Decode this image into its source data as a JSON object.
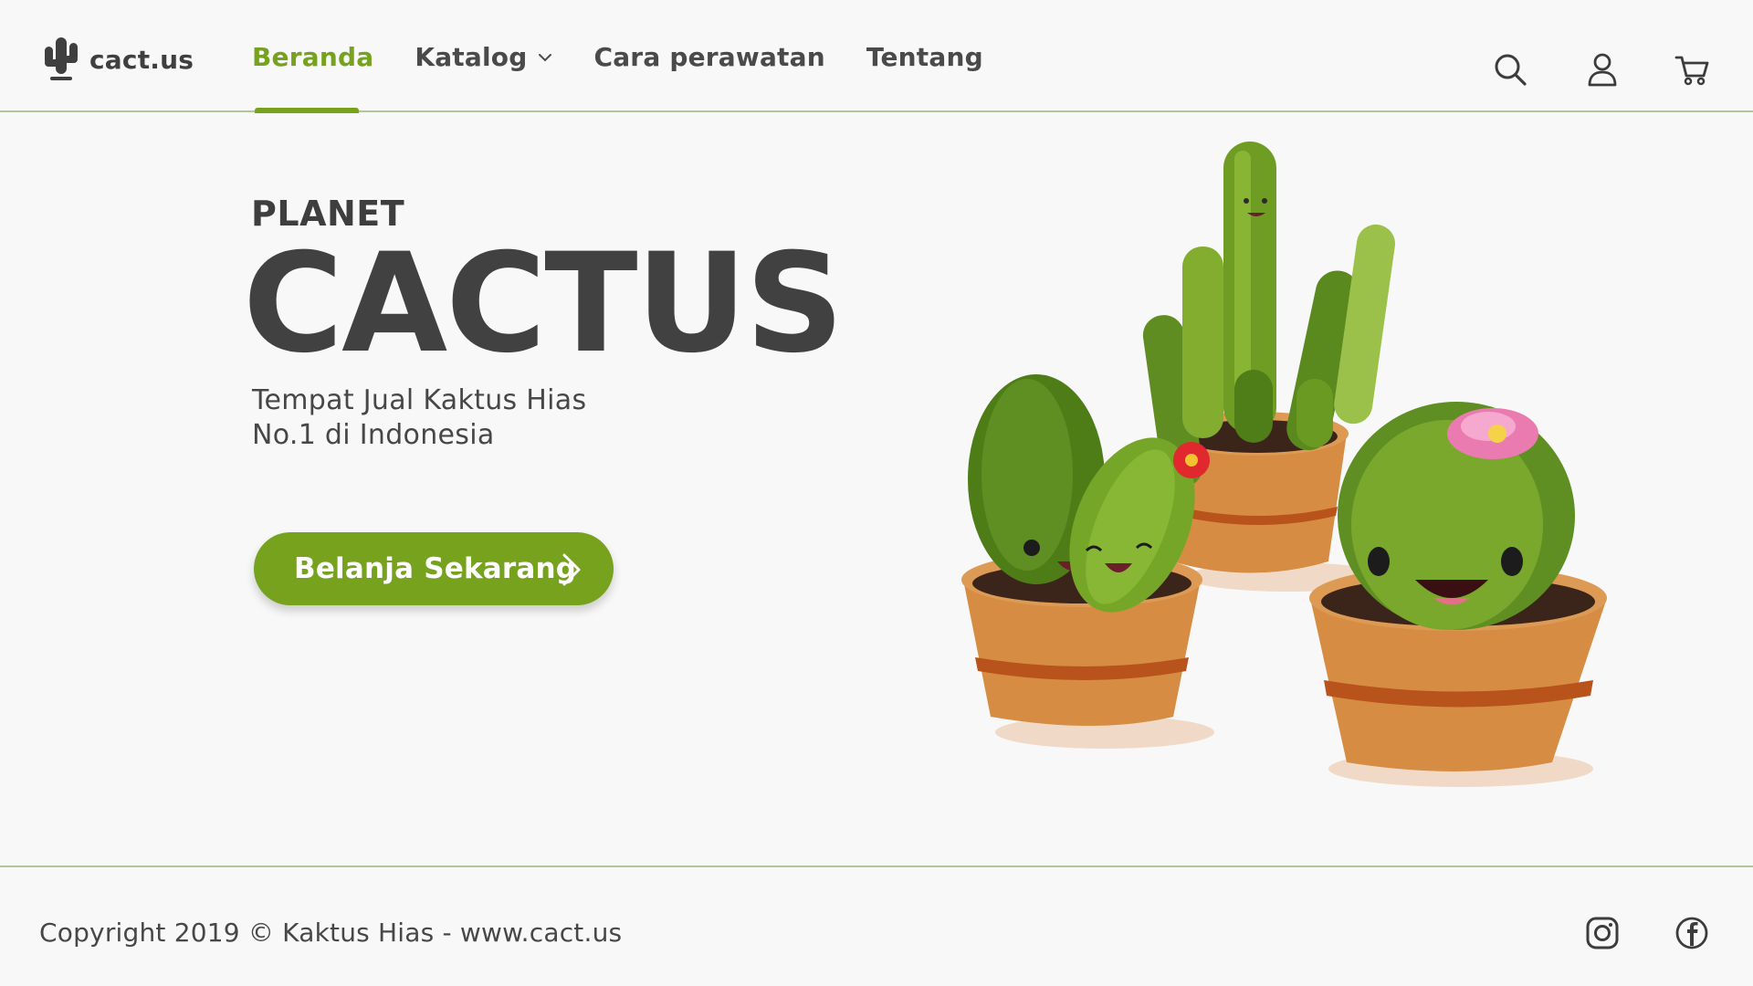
{
  "brand": {
    "name": "cact.us",
    "icon": "cactus-logo-icon"
  },
  "nav": {
    "items": [
      {
        "label": "Beranda",
        "active": true
      },
      {
        "label": "Katalog",
        "has_dropdown": true
      },
      {
        "label": "Cara perawatan"
      },
      {
        "label": "Tentang"
      }
    ]
  },
  "header_actions": {
    "icons": [
      "search-icon",
      "user-icon",
      "cart-icon"
    ]
  },
  "hero": {
    "kicker": "PLANET",
    "title": "CACTUS",
    "subtitle_line1": "Tempat Jual Kaktus Hias",
    "subtitle_line2": "No.1 di Indonesia",
    "cta_label": "Belanja Sekarang"
  },
  "footer": {
    "copyright": "Copyright 2019 © Kaktus Hias - www.cact.us",
    "social_icons": [
      "instagram-icon",
      "facebook-icon"
    ]
  },
  "colors": {
    "accent": "#76a21e",
    "text": "#474747",
    "background": "#f8f8f8",
    "divider": "#b4c597",
    "pot": "#d68c42"
  }
}
